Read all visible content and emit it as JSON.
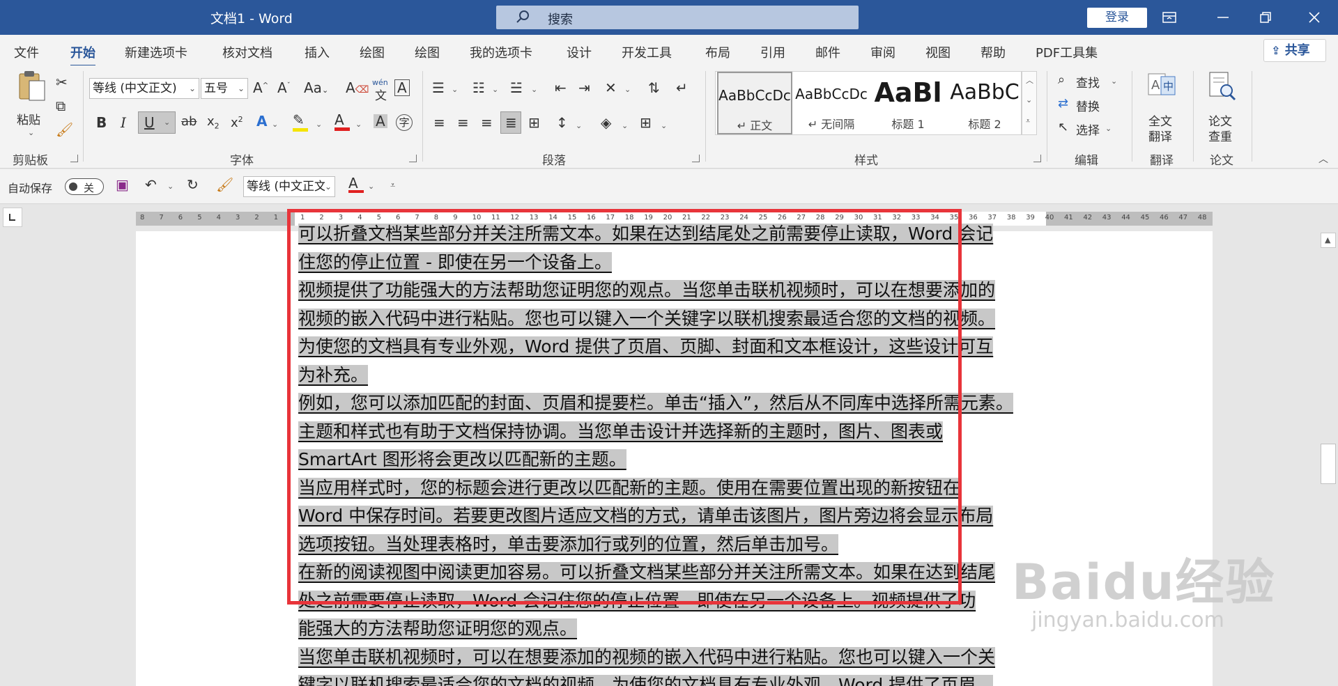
{
  "titlebar": {
    "title": "文档1  -  Word",
    "search_placeholder": "搜索",
    "login": "登录"
  },
  "tabs": [
    "文件",
    "开始",
    "新建选项卡",
    "核对文档",
    "插入",
    "绘图",
    "绘图",
    "我的选项卡",
    "设计",
    "开发工具",
    "布局",
    "引用",
    "邮件",
    "审阅",
    "视图",
    "帮助",
    "PDF工具集"
  ],
  "active_tab": "开始",
  "share": "共享",
  "ribbon": {
    "clipboard": {
      "paste": "粘贴",
      "group": "剪贴板"
    },
    "font": {
      "name": "等线 (中文正文)",
      "size": "五号",
      "group": "字体",
      "wen_top": "wén",
      "wen_bottom": "文"
    },
    "paragraph": {
      "group": "段落"
    },
    "styles": {
      "group": "样式",
      "items": [
        {
          "preview": "AaBbCcDc",
          "name": "↵ 正文"
        },
        {
          "preview": "AaBbCcDc",
          "name": "↵ 无间隔"
        },
        {
          "preview": "AaBl",
          "name": "标题 1"
        },
        {
          "preview": "AaBbC",
          "name": "标题 2"
        }
      ]
    },
    "editing": {
      "find": "查找",
      "replace": "替换",
      "select": "选择",
      "group": "编辑"
    },
    "translate": {
      "label1": "全文",
      "label2": "翻译",
      "group": "翻译"
    },
    "paper": {
      "label1": "论文",
      "label2": "查重",
      "group": "论文"
    }
  },
  "qat": {
    "autosave": "自动保存",
    "toggle": "关",
    "font": "等线 (中文正文)"
  },
  "ruler": {
    "left_numbers": [
      "8",
      "7",
      "6",
      "5",
      "4",
      "3",
      "2",
      "1"
    ],
    "right_numbers": [
      "1",
      "2",
      "3",
      "4",
      "5",
      "6",
      "7",
      "8",
      "9",
      "10",
      "11",
      "12",
      "13",
      "14",
      "15",
      "16",
      "17",
      "18",
      "19",
      "20",
      "21",
      "22",
      "23",
      "24",
      "25",
      "26",
      "27",
      "28",
      "29",
      "30",
      "31",
      "32",
      "33",
      "34",
      "35",
      "36",
      "37",
      "38",
      "39",
      "40",
      "41",
      "42",
      "43",
      "44",
      "45",
      "46",
      "47",
      "48"
    ]
  },
  "document": {
    "lines": [
      "可以折叠文档某些部分并关注所需文本。如果在达到结尾处之前需要停止读取，Word 会记",
      "住您的停止位置 - 即使在另一个设备上。",
      "视频提供了功能强大的方法帮助您证明您的观点。当您单击联机视频时，可以在想要添加的",
      "视频的嵌入代码中进行粘贴。您也可以键入一个关键字以联机搜索最适合您的文档的视频。",
      "为使您的文档具有专业外观，Word 提供了页眉、页脚、封面和文本框设计，这些设计可互",
      "为补充。",
      "例如，您可以添加匹配的封面、页眉和提要栏。单击“插入”，然后从不同库中选择所需元素。",
      "主题和样式也有助于文档保持协调。当您单击设计并选择新的主题时，图片、图表或",
      "SmartArt 图形将会更改以匹配新的主题。",
      "当应用样式时，您的标题会进行更改以匹配新的主题。使用在需要位置出现的新按钮在",
      "Word 中保存时间。若要更改图片适应文档的方式，请单击该图片，图片旁边将会显示布局",
      "选项按钮。当处理表格时，单击要添加行或列的位置，然后单击加号。",
      "在新的阅读视图中阅读更加容易。可以折叠文档某些部分并关注所需文本。如果在达到结尾",
      "处之前需要停止读取，Word 会记住您的停止位置 - 即使在另一个设备上。视频提供了功",
      "能强大的方法帮助您证明您的观点。",
      "当您单击联机视频时，可以在想要添加的视频的嵌入代码中进行粘贴。您也可以键入一个关",
      "键字以联机搜索最适合您的文档的视频。为使您的文档具有专业外观，Word 提供了页眉、"
    ]
  },
  "watermark": {
    "brand": "Baidu经验",
    "url": "jingyan.baidu.com"
  },
  "colors": {
    "word_blue": "#2b579a",
    "highlight_red": "#e8343a",
    "selection_gray": "#c8c8c8"
  }
}
